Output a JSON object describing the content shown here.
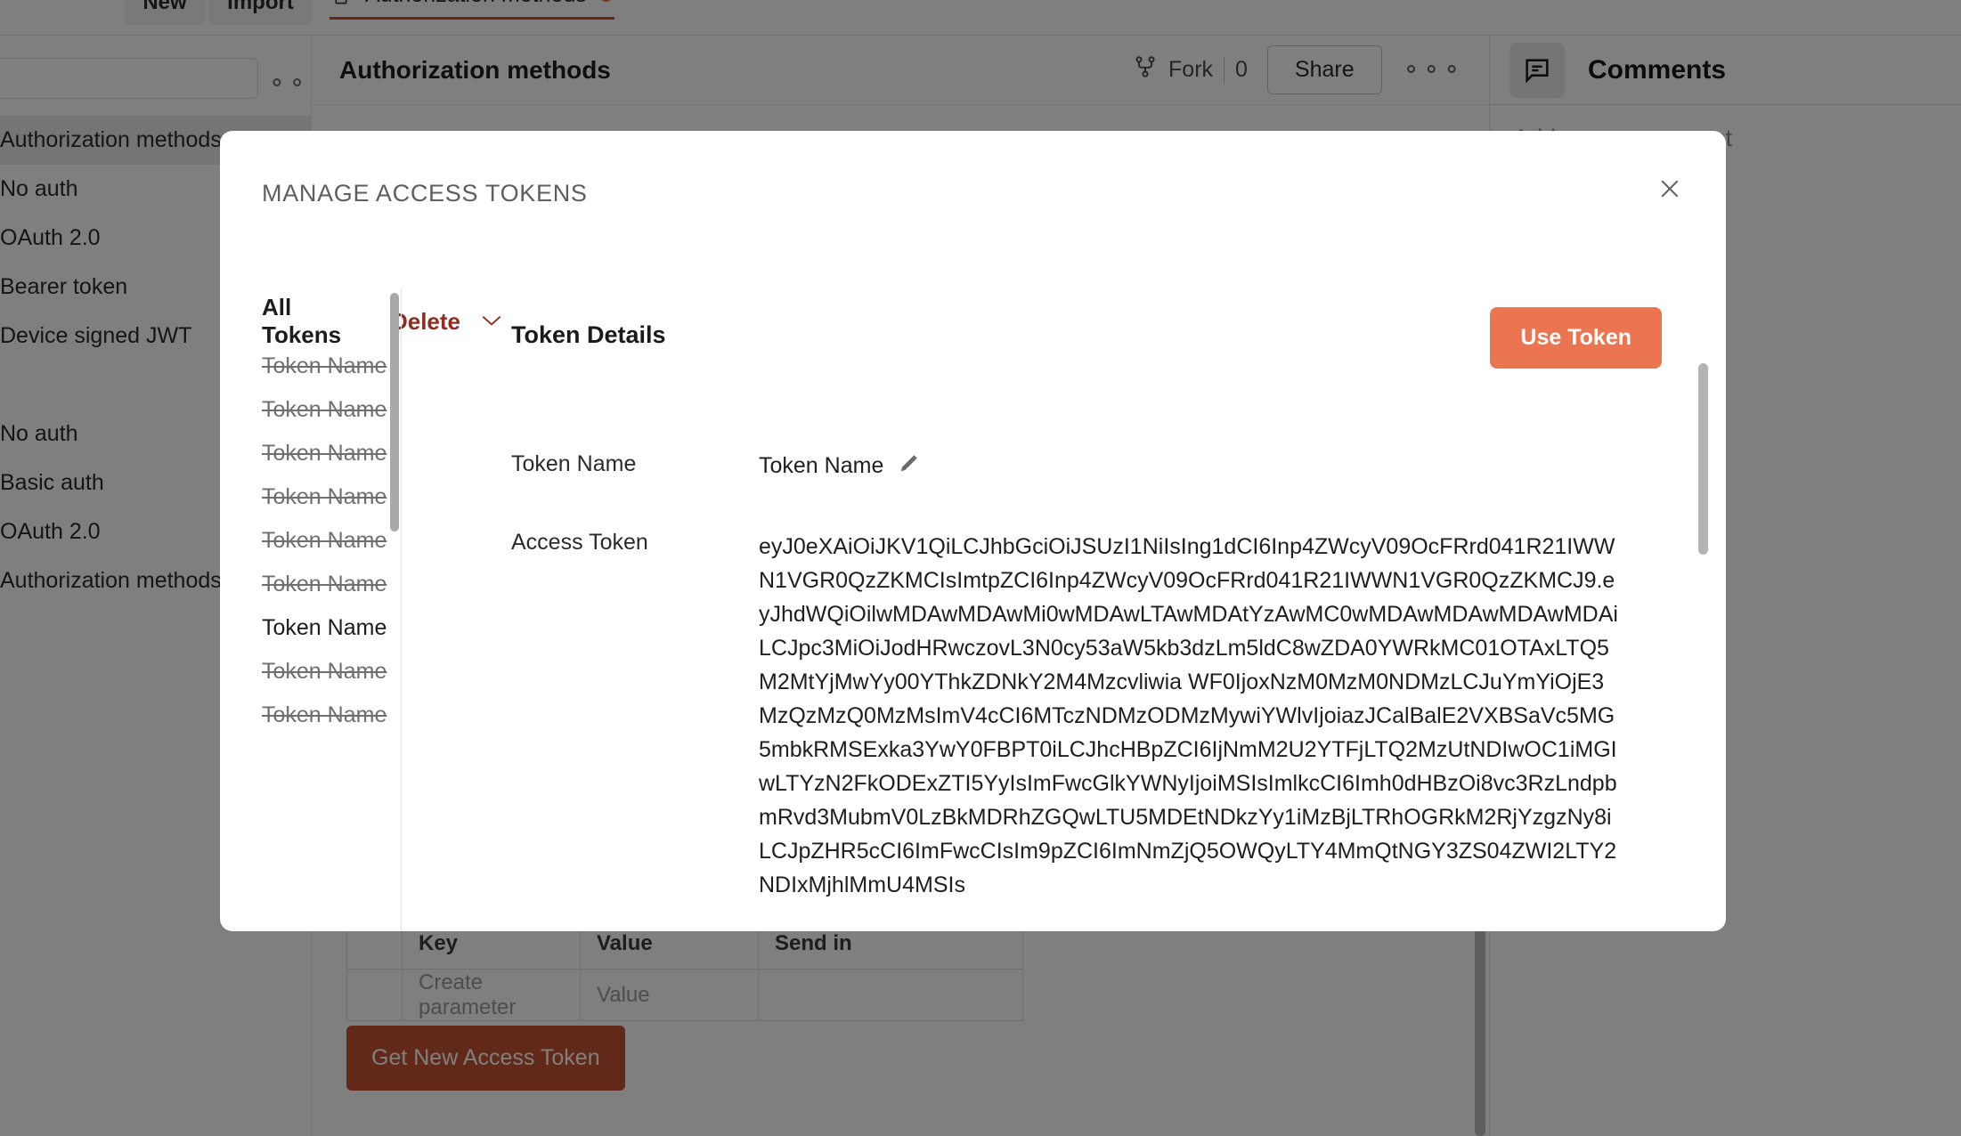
{
  "app": {
    "toolbar": {
      "new_label": "New",
      "import_label": "Import",
      "overflow_icon": "more-horizontal-icon",
      "search_placeholder": ""
    },
    "tab": {
      "label": "Authorization methods",
      "unsaved_dot": "unsaved-changes-dot",
      "collection_icon": "collection-icon",
      "add_tab_icon": "plus-icon",
      "tab_overflow_icon": "chevron-down-icon"
    },
    "sidebar": {
      "items": [
        {
          "label": "Authorization methods",
          "selected": true
        },
        {
          "label": "No auth",
          "selected": false
        },
        {
          "label": "OAuth 2.0",
          "selected": false
        },
        {
          "label": "Bearer token",
          "selected": false
        },
        {
          "label": "Device signed JWT",
          "selected": false
        },
        {
          "label": "",
          "selected": false
        },
        {
          "label": "No auth",
          "selected": false
        },
        {
          "label": "Basic auth",
          "selected": false
        },
        {
          "label": "OAuth 2.0",
          "selected": false
        },
        {
          "label": "Authorization methods",
          "selected": false
        }
      ]
    },
    "main_header": {
      "title": "Authorization methods",
      "fork_label": "Fork",
      "fork_count": "0",
      "share_label": "Share",
      "fork_icon": "fork-icon",
      "overflow_icon": "more-horizontal-icon"
    },
    "params_table": {
      "columns": [
        "",
        "Key",
        "Value",
        "Send in"
      ],
      "rows": [
        {
          "key": "Create parameter",
          "value": "Value",
          "send_in": ""
        }
      ]
    },
    "get_new_access_token_label": "Get New Access Token",
    "comments": {
      "icon": "comment-icon",
      "title": "Comments",
      "new_comment_placeholder": "Add a new comment"
    }
  },
  "modal": {
    "title": "MANAGE ACCESS TOKENS",
    "close_icon": "close-icon",
    "tokens_panel": {
      "heading": "All Tokens",
      "delete_label": "Delete",
      "delete_chevron_icon": "chevron-down-icon",
      "items": [
        {
          "label": "Token Name",
          "expired": true,
          "active": false
        },
        {
          "label": "Token Name",
          "expired": true,
          "active": false
        },
        {
          "label": "Token Name",
          "expired": true,
          "active": false
        },
        {
          "label": "Token Name",
          "expired": true,
          "active": false
        },
        {
          "label": "Token Name",
          "expired": true,
          "active": false
        },
        {
          "label": "Token Name",
          "expired": true,
          "active": false
        },
        {
          "label": "Token Name",
          "expired": false,
          "active": true
        },
        {
          "label": "Token Name",
          "expired": true,
          "active": false
        },
        {
          "label": "Token Name",
          "expired": true,
          "active": false
        }
      ]
    },
    "details_panel": {
      "heading": "Token Details",
      "use_token_label": "Use Token",
      "token_name_label": "Token Name",
      "token_name_value": "Token Name",
      "edit_icon": "pencil-icon",
      "access_token_label": "Access Token",
      "access_token_value": "eyJ0eXAiOiJKV1QiLCJhbGciOiJSUzI1NiIsIng1dCI6Inp4ZWcyV09OcFRrd041R21IWWN1VGR0QzZKMCIsImtpZCI6Inp4ZWcyV09OcFRrd041R21IWWN1VGR0QzZKMCJ9.eyJhdWQiOilwMDAwMDAwMi0wMDAwLTAwMDAtYzAwMC0wMDAwMDAwMDAwMDAiLCJpc3MiOiJodHRwczovL3N0cy53aW5kb3dzLm5ldC8wZDA0YWRkMC01OTAxLTQ5M2MtYjMwYy00YThkZDNkY2M4Mzcvliwia WF0IjoxNzM0MzM0NDMzLCJuYmYiOjE3MzQzMzQ0MzMsImV4cCI6MTczNDMzODMzMywiYWlvIjoiazJCalBalE2VXBSaVc5MG5mbkRMSExka3YwY0FBPT0iLCJhcHBpZCI6IjNmM2U2YTFjLTQ2MzUtNDIwOC1iMGIwLTYzN2FkODExZTI5YyIsImFwcGlkYWNyIjoiMSIsImlkcCI6Imh0dHBzOi8vc3RzLndpbmRvd3MubmV0LzBkMDRhZGQwLTU5MDEtNDkzYy1iMzBjLTRhOGRkM2RjYzgzNy8iLCJpZHR5cCI6ImFwcCIsIm9pZCI6ImNmZjQ5OWQyLTY4MmQtNGY3ZS04ZWI2LTY2NDIxMjhlMmU4MSIs"
    }
  }
}
